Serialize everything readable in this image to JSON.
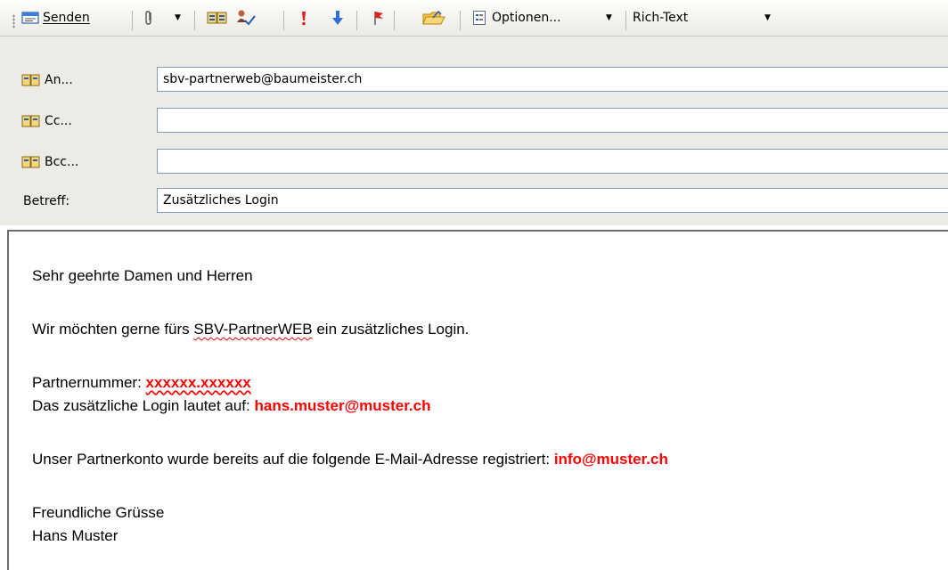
{
  "toolbar": {
    "send_label": "Senden",
    "options_label": "Optionen...",
    "format_value": "Rich-Text",
    "icons": [
      "send-icon",
      "attach-icon",
      "address-book-icon",
      "check-names-icon",
      "high-importance-icon",
      "low-importance-icon",
      "flag-icon",
      "folder-icon",
      "options-icon"
    ]
  },
  "header": {
    "to_label": "An...",
    "to_value": "sbv-partnerweb@baumeister.ch",
    "cc_label": "Cc...",
    "cc_value": "",
    "bcc_label": "Bcc...",
    "bcc_value": "",
    "subject_label": "Betreff:",
    "subject_value": "Zusätzliches Login"
  },
  "message": {
    "greeting": "Sehr geehrte Damen und Herren",
    "intro_before": "Wir möchten gerne fürs ",
    "intro_brand": "SBV-PartnerWEB",
    "intro_after": " ein zusätzliches Login.",
    "partner_label": "Partnernummer: ",
    "partner_value": "xxxxxx.xxxxxx",
    "login_label": "Das zusätzliche Login lautet auf: ",
    "login_value": "hans.muster@muster.ch",
    "account_label": "Unser Partnerkonto wurde bereits auf die folgende E-Mail-Adresse registriert: ",
    "account_value": "info@muster.ch",
    "closing": "Freundliche Grüsse",
    "signature": "Hans Muster"
  },
  "colors": {
    "highlight": "#ff0000",
    "toolbar_bg": "#ecebe5",
    "field_border": "#7f9db9"
  }
}
